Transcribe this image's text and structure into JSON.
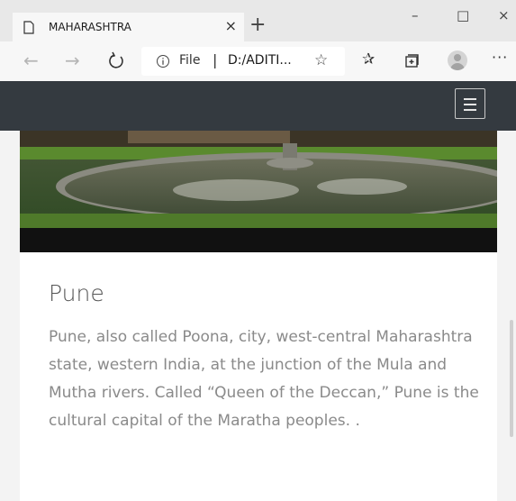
{
  "tab": {
    "title": "MAHARASHTRA",
    "close": "×",
    "new_tab": "+"
  },
  "window_controls": {
    "minimize": "–",
    "maximize": "□",
    "close": "×"
  },
  "nav": {
    "back": "←",
    "forward": "→",
    "address": {
      "file_label": "File",
      "separator": "|",
      "url": "D:/ADITI...",
      "star": "☆"
    },
    "favorites": "✰",
    "more": "···"
  },
  "card": {
    "title": "Pune",
    "description": "Pune, also called Poona, city, west-central Maharashtra state, western India, at the junction of the Mula and Mutha rivers. Called “Queen of the Deccan,” Pune is the cultural capital of the Maratha peoples. ."
  },
  "colors": {
    "header_bg": "#343a40",
    "text_muted": "#8a8a8a",
    "title": "#555555"
  }
}
